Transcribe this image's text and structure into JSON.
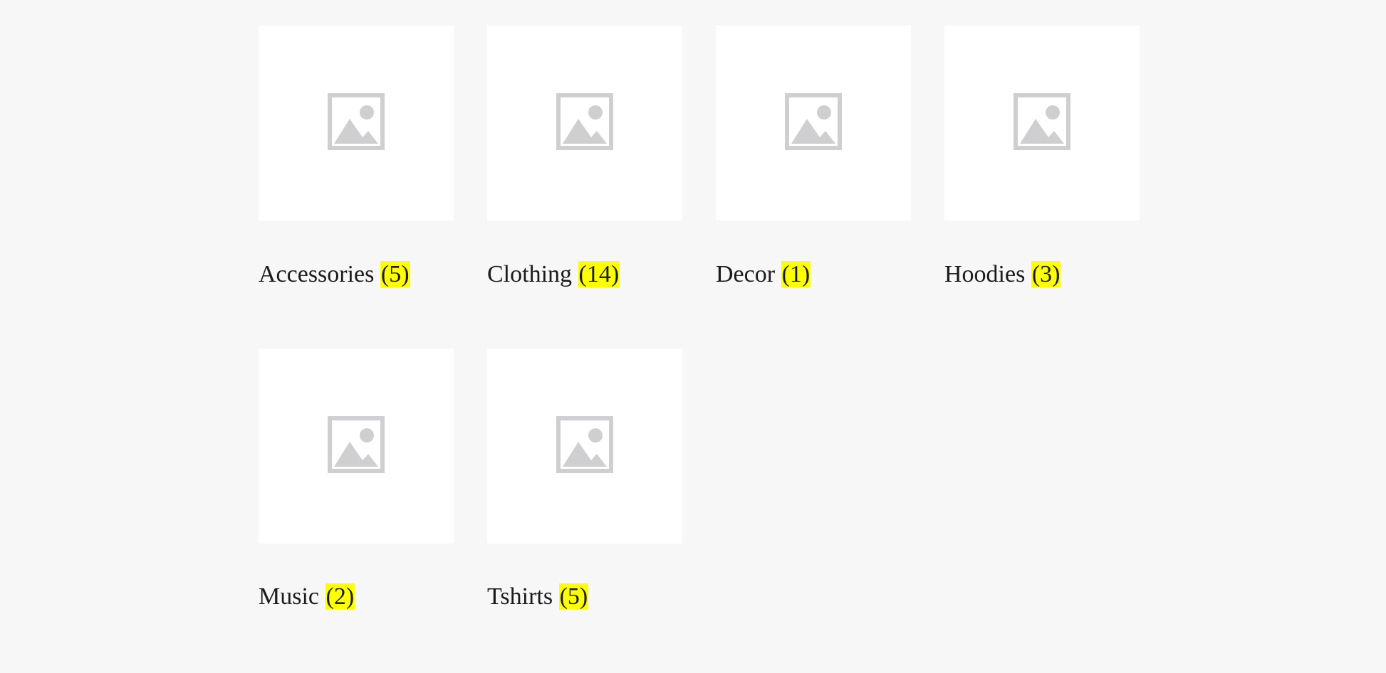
{
  "page": {
    "background_color": "#f7f7f7",
    "card_color": "#ffffff",
    "highlight_color": "#ffff00",
    "text_color": "#1b1b1b",
    "placeholder_icon_color": "#cfcfd1"
  },
  "categories": [
    {
      "name": "Accessories",
      "count": "(5)",
      "icon": "image-placeholder-icon"
    },
    {
      "name": "Clothing",
      "count": "(14)",
      "icon": "image-placeholder-icon"
    },
    {
      "name": "Decor",
      "count": "(1)",
      "icon": "image-placeholder-icon"
    },
    {
      "name": "Hoodies",
      "count": "(3)",
      "icon": "image-placeholder-icon"
    },
    {
      "name": "Music",
      "count": "(2)",
      "icon": "image-placeholder-icon"
    },
    {
      "name": "Tshirts",
      "count": "(5)",
      "icon": "image-placeholder-icon"
    }
  ]
}
